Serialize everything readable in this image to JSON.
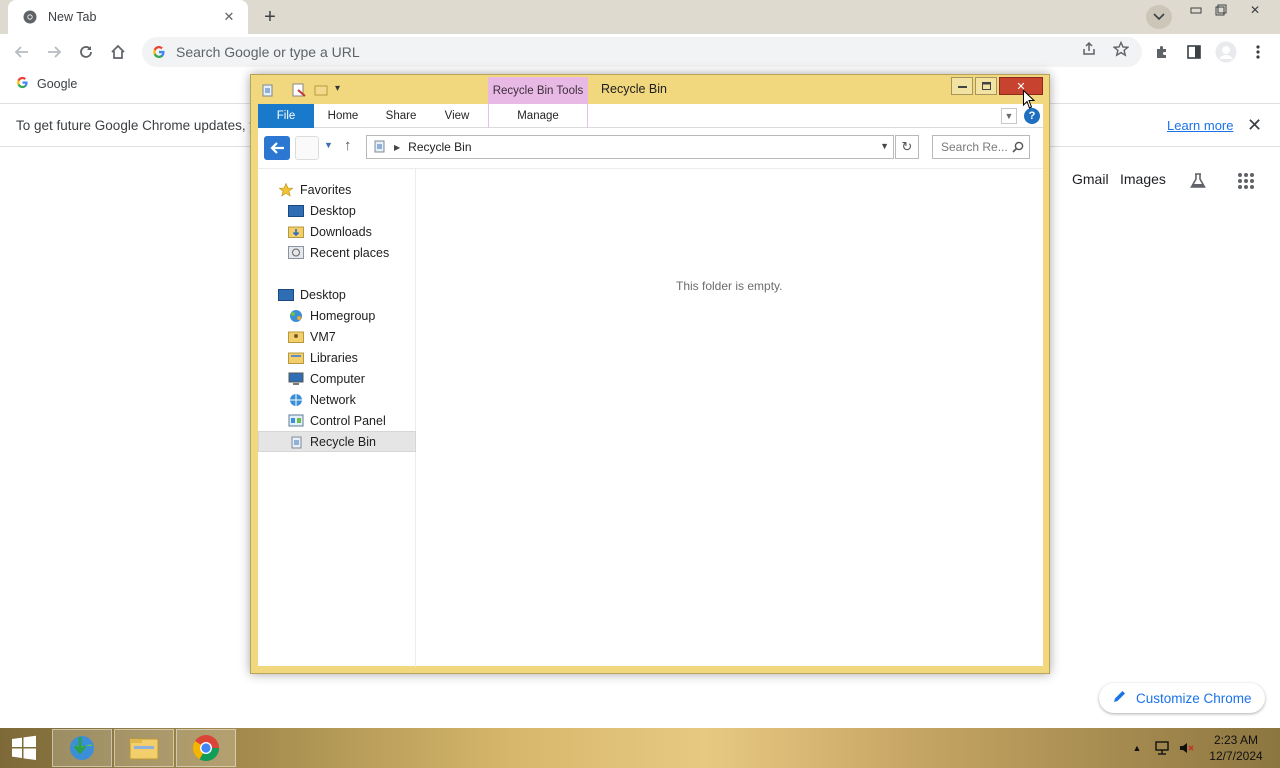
{
  "chrome": {
    "tab_title": "New Tab",
    "omnibox_placeholder": "Search Google or type a URL",
    "bookmark_google": "Google",
    "infobar_text": "To get future Google Chrome updates, yo",
    "infobar_link": "Learn more",
    "ntp_links": {
      "gmail": "Gmail",
      "images": "Images"
    },
    "customize_label": "Customize Chrome"
  },
  "explorer": {
    "contextual_tab": "Recycle Bin Tools",
    "title": "Recycle Bin",
    "ribbon_tabs": {
      "file": "File",
      "home": "Home",
      "share": "Share",
      "view": "View",
      "manage": "Manage"
    },
    "address": "Recycle Bin",
    "search_placeholder": "Search Re...",
    "help_label": "?",
    "empty_message": "This folder is empty.",
    "nav_pane": {
      "favorites": "Favorites",
      "fav_items": [
        "Desktop",
        "Downloads",
        "Recent places"
      ],
      "desktop": "Desktop",
      "desktop_items": [
        "Homegroup",
        "VM7",
        "Libraries",
        "Computer",
        "Network",
        "Control Panel",
        "Recycle Bin"
      ]
    }
  },
  "taskbar": {
    "time": "2:23 AM",
    "date": "12/7/2024"
  },
  "colors": {
    "window_frame": "#f1d77d",
    "file_tab": "#1979ca",
    "contextual_tab": "#e9b9e6",
    "close_button": "#c8432f",
    "chrome_link": "#1a73e8"
  }
}
